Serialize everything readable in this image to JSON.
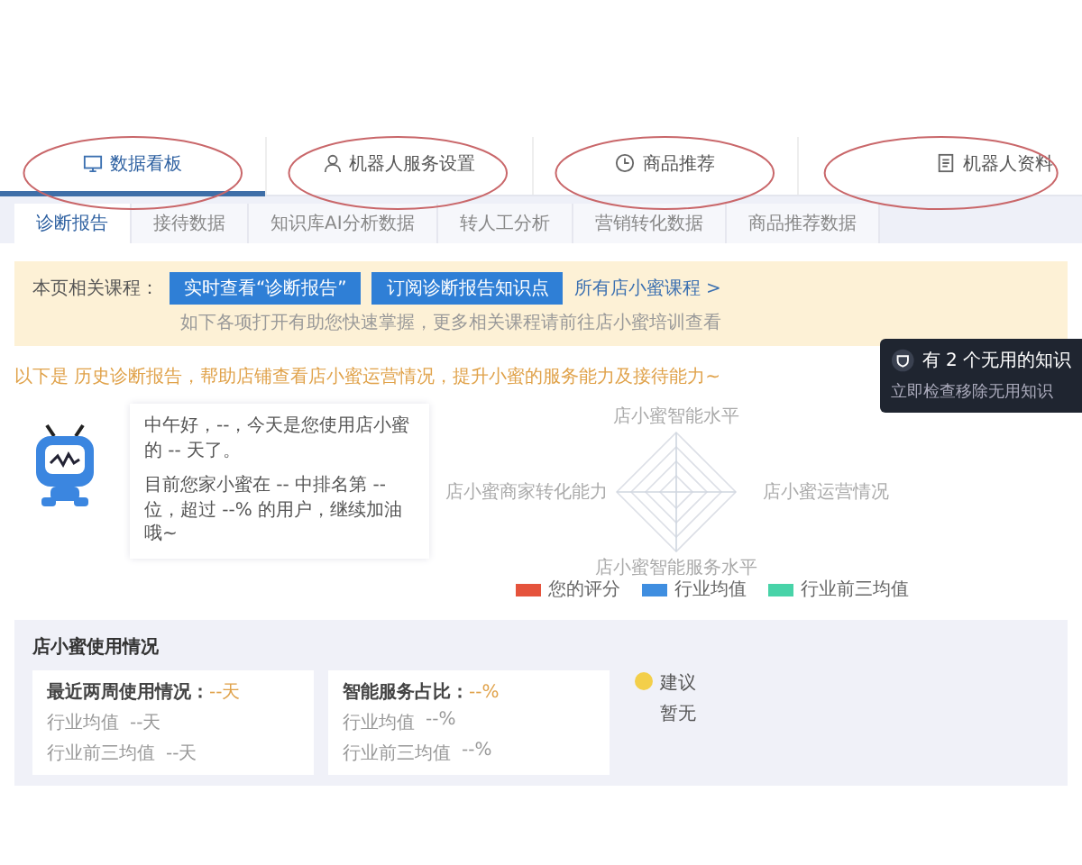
{
  "top_tabs": [
    {
      "label": "数据看板",
      "selected": true,
      "circled": true
    },
    {
      "label": "机器人服务设置",
      "selected": false,
      "circled": true
    },
    {
      "label": "商品推荐",
      "selected": false,
      "circled": true
    },
    {
      "label": "机器人资料",
      "selected": false,
      "circled": true
    }
  ],
  "sub_tabs": [
    {
      "label": "诊断报告",
      "selected": true
    },
    {
      "label": "接待数据",
      "selected": false
    },
    {
      "label": "知识库AI分析数据",
      "selected": false
    },
    {
      "label": "转人工分析",
      "selected": false
    },
    {
      "label": "营销转化数据",
      "selected": false
    },
    {
      "label": "商品推荐数据",
      "selected": false
    }
  ],
  "course_banner": {
    "label": "本页相关课程：",
    "buttons": [
      "实时查看“诊断报告”",
      "订阅诊断报告知识点"
    ],
    "link": "所有店小蜜课程 >",
    "note": "如下各项打开有助您快速掌握，更多相关课程请前往店小蜜培训查看"
  },
  "intro": "以下是 历史诊断报告，帮助店铺查看店小蜜运营情况，提升小蜜的服务能力及接待能力~",
  "greeting": {
    "lines": [
      "中午好，--，今天是您使用店小蜜的 -- 天了。",
      "目前您家小蜜在 -- 中排名第 -- 位，超过 --% 的用户，继续加油哦~"
    ]
  },
  "radar": {
    "axis_labels": [
      "店小蜜智能水平",
      "店小蜜运营情况",
      "店小蜜智能服务水平",
      "店小蜜商家转化能力"
    ],
    "legend": [
      {
        "label": "您的评分",
        "color": "#e5533c"
      },
      {
        "label": "行业均值",
        "color": "#3f8ee0"
      },
      {
        "label": "行业前三均值",
        "color": "#48d3a8"
      }
    ]
  },
  "notice": {
    "title": "有 2 个无用的知识",
    "subtitle": "立即检查移除无用知识"
  },
  "usage": {
    "title": "店小蜜使用情况",
    "cards": [
      {
        "heading": "最近两周使用情况：",
        "value": "--天",
        "rows": [
          {
            "label": "行业均值",
            "value": "--天"
          },
          {
            "label": "行业前三均值",
            "value": "--天"
          }
        ]
      },
      {
        "heading": "智能服务占比：",
        "value": "--%",
        "rows": [
          {
            "label": "行业均值",
            "value": "--%"
          },
          {
            "label": "行业前三均值",
            "value": "--%"
          }
        ]
      }
    ],
    "tip": {
      "title": "建议",
      "text": "暂无"
    }
  }
}
